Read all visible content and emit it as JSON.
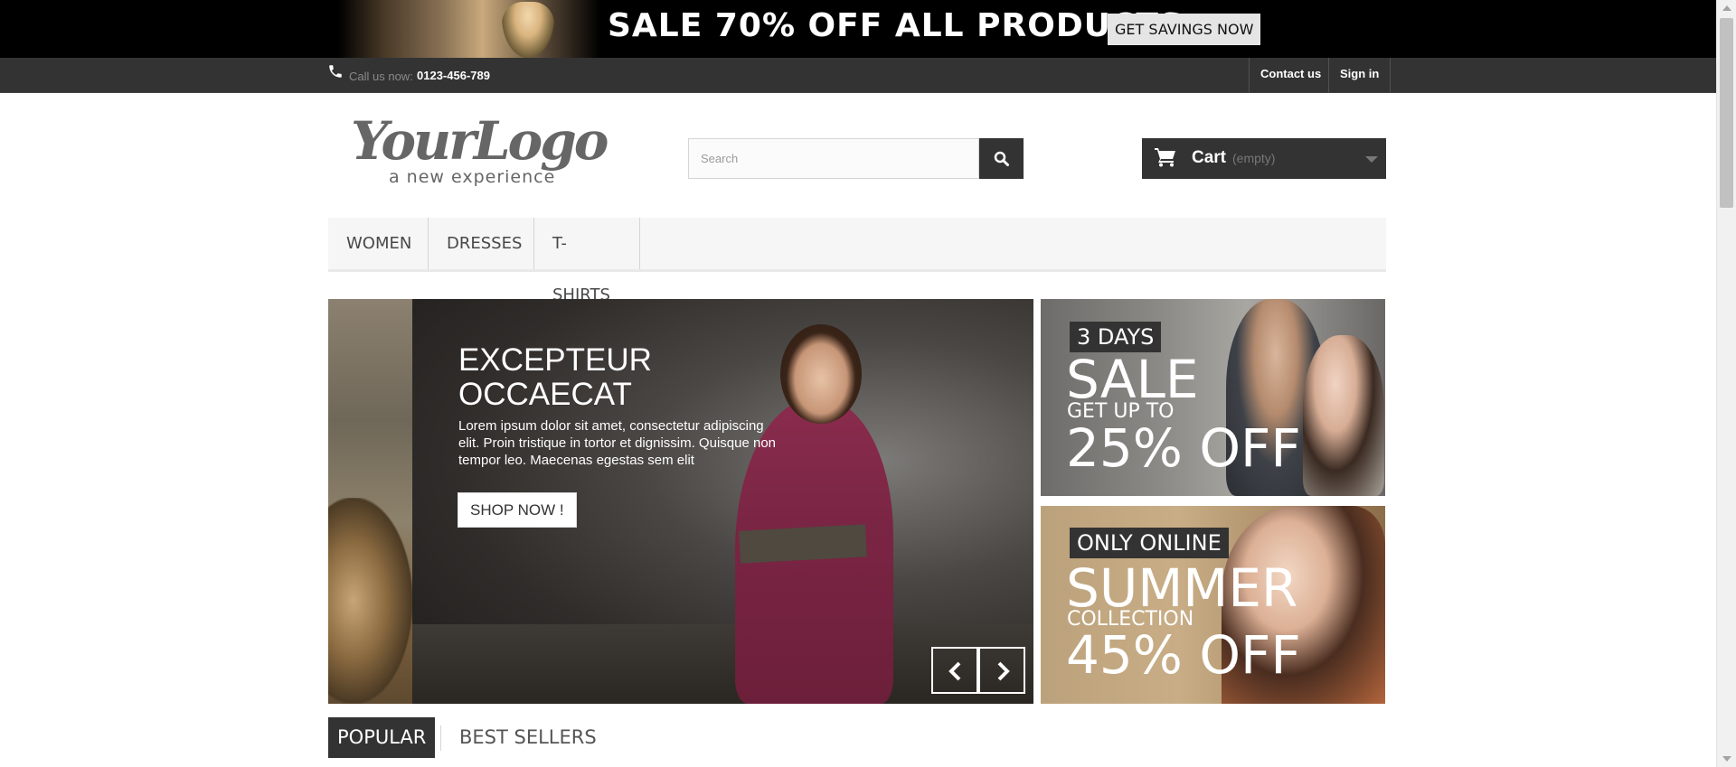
{
  "promo": {
    "text": "SALE 70% OFF ALL PRODUCTS",
    "button": "GET SAVINGS NOW"
  },
  "topbar": {
    "call_label": "Call us now:",
    "phone": "0123-456-789",
    "contact": "Contact us",
    "signin": "Sign in"
  },
  "header": {
    "logo_text": "YourLogo",
    "logo_tagline": "a new experience",
    "search_placeholder": "Search",
    "cart_label": "Cart",
    "cart_status": "(empty)"
  },
  "nav": {
    "items": [
      "WOMEN",
      "DRESSES",
      "T-SHIRTS"
    ]
  },
  "slider": {
    "title_line1": "EXCEPTEUR",
    "title_line2": "OCCAECAT",
    "description": "Lorem ipsum dolor sit amet, consectetur adipiscing elit. Proin tristique in tortor et dignissim. Quisque non tempor leo. Maecenas egestas sem elit",
    "button": "SHOP NOW !"
  },
  "banners": [
    {
      "tag": "3 DAYS",
      "big1": "SALE",
      "mid": "GET UP TO",
      "big2": "25% OFF"
    },
    {
      "tag": "ONLY ONLINE",
      "big1": "SUMMER",
      "mid": "COLLECTION",
      "big2": "45% OFF"
    }
  ],
  "tabs": {
    "popular": "POPULAR",
    "best_sellers": "BEST SELLERS"
  },
  "colors": {
    "dark": "#333333",
    "promo_bg": "#000000",
    "nav_bg": "#f6f6f6"
  },
  "icons": {
    "phone": "phone-icon",
    "search": "search-icon",
    "cart": "cart-icon",
    "prev": "chevron-left-icon",
    "next": "chevron-right-icon"
  }
}
